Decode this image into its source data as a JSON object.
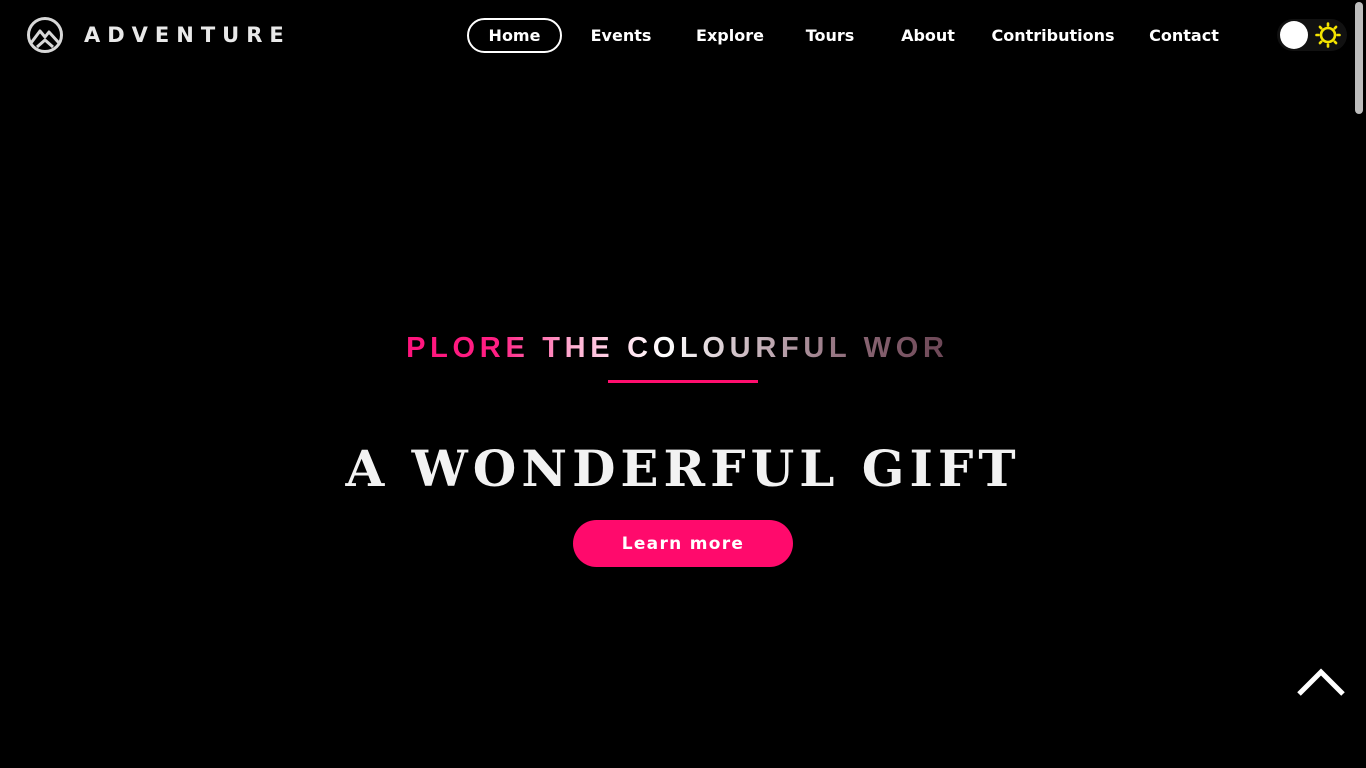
{
  "header": {
    "brand_name": "ADVENTURE",
    "logo_icon": "mountain-logo-icon",
    "nav": [
      {
        "label": "Home",
        "active": true
      },
      {
        "label": "Events",
        "active": false
      },
      {
        "label": "Explore",
        "active": false
      },
      {
        "label": "Tours",
        "active": false
      },
      {
        "label": "About",
        "active": false
      },
      {
        "label": "Contributions",
        "active": false
      },
      {
        "label": "Contact",
        "active": false
      }
    ],
    "theme_toggle": {
      "icon": "sun-icon",
      "icon_color": "#f5e400"
    }
  },
  "hero": {
    "subtitle": "EXPLORE THE COLOURFUL WORLD",
    "headline": "A WONDERFUL GIFT",
    "cta_label": "Learn more",
    "accent_color": "#ff0a6c"
  },
  "back_to_top": {
    "icon": "chevron-up-icon"
  },
  "colors": {
    "background": "#000000",
    "text": "#ffffff",
    "accent": "#ff0a6c"
  }
}
